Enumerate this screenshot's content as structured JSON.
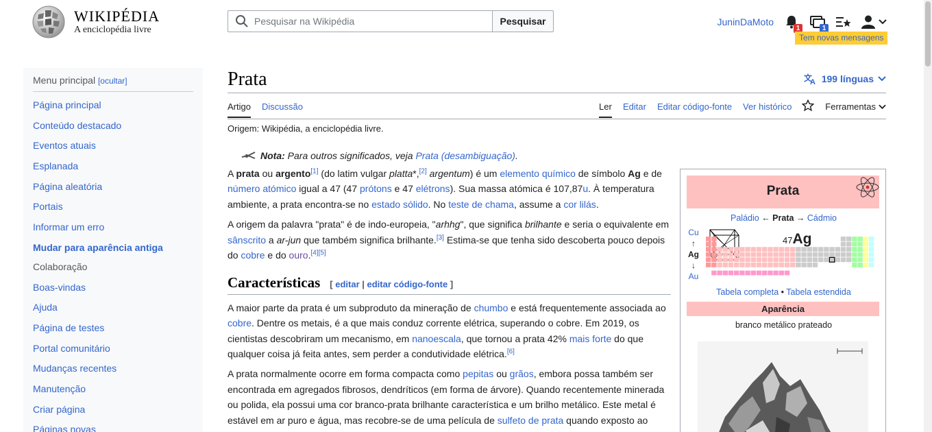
{
  "header": {
    "wordmark": "WIKIPÉDIA",
    "tagline": "A enciclopédia livre",
    "search_placeholder": "Pesquisar na Wikipédia",
    "search_button": "Pesquisar",
    "username": "JuninDaMoto",
    "notifications_count": "1",
    "messages_count": "1",
    "new_messages": "Tem novas mensagens"
  },
  "sidebar": {
    "title": "Menu principal",
    "hide": "[ocultar]",
    "items": [
      "Página principal",
      "Conteúdo destacado",
      "Eventos atuais",
      "Esplanada",
      "Página aleatória",
      "Portais",
      "Informar um erro",
      "Mudar para aparência antiga"
    ],
    "section2": "Colaboração",
    "items2": [
      "Boas-vindas",
      "Ajuda",
      "Página de testes",
      "Portal comunitário",
      "Mudanças recentes",
      "Manutenção",
      "Criar página",
      "Páginas novas"
    ]
  },
  "page": {
    "title": "Prata",
    "languages": "199 línguas",
    "tab_article": "Artigo",
    "tab_talk": "Discussão",
    "tab_read": "Ler",
    "tab_edit": "Editar",
    "tab_edit_source": "Editar código-fonte",
    "tab_history": "Ver histórico",
    "tools": "Ferramentas",
    "origin": "Origem: Wikipédia, a enciclopédia livre.",
    "hatnote_label": "Nota:",
    "hatnote_text": " Para outros significados, veja ",
    "hatnote_link": "Prata (desambiguação)",
    "hatnote_end": "."
  },
  "section": {
    "title": "Características",
    "edit": "editar",
    "edit_source": "editar código-fonte"
  },
  "infobox": {
    "title": "Prata",
    "prev": "Paládio",
    "current": "Prata",
    "next": "Cádmio",
    "above": "Cu",
    "symbol_label": "Ag",
    "below": "Au",
    "atomic_number": "47",
    "symbol": "Ag",
    "table_full": "Tabela completa",
    "table_extended": "Tabela estendida",
    "appearance_head": "Aparência",
    "appearance": "branco metálico prateado"
  }
}
